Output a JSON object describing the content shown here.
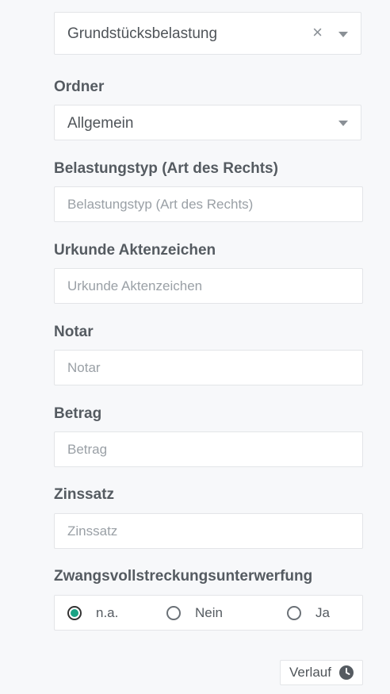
{
  "top_select": {
    "value": "Grundstücksbelastung",
    "clear_symbol": "×"
  },
  "ordner": {
    "label": "Ordner",
    "value": "Allgemein"
  },
  "fields": {
    "belastungstyp": {
      "label": "Belastungstyp (Art des Rechts)",
      "placeholder": "Belastungstyp (Art des Rechts)",
      "value": ""
    },
    "urkunde": {
      "label": "Urkunde Aktenzeichen",
      "placeholder": "Urkunde Aktenzeichen",
      "value": ""
    },
    "notar": {
      "label": "Notar",
      "placeholder": "Notar",
      "value": ""
    },
    "betrag": {
      "label": "Betrag",
      "placeholder": "Betrag",
      "value": ""
    },
    "zinssatz": {
      "label": "Zinssatz",
      "placeholder": "Zinssatz",
      "value": ""
    }
  },
  "zwangsvollstreckung": {
    "label": "Zwangsvollstreckungsunterwerfung",
    "options": [
      "n.a.",
      "Nein",
      "Ja"
    ],
    "selected": "n.a."
  },
  "history_button": {
    "label": "Verlauf",
    "icon": "clock-icon"
  },
  "colors": {
    "radio_selected": "#1aa384",
    "background": "#f7f8fa"
  }
}
